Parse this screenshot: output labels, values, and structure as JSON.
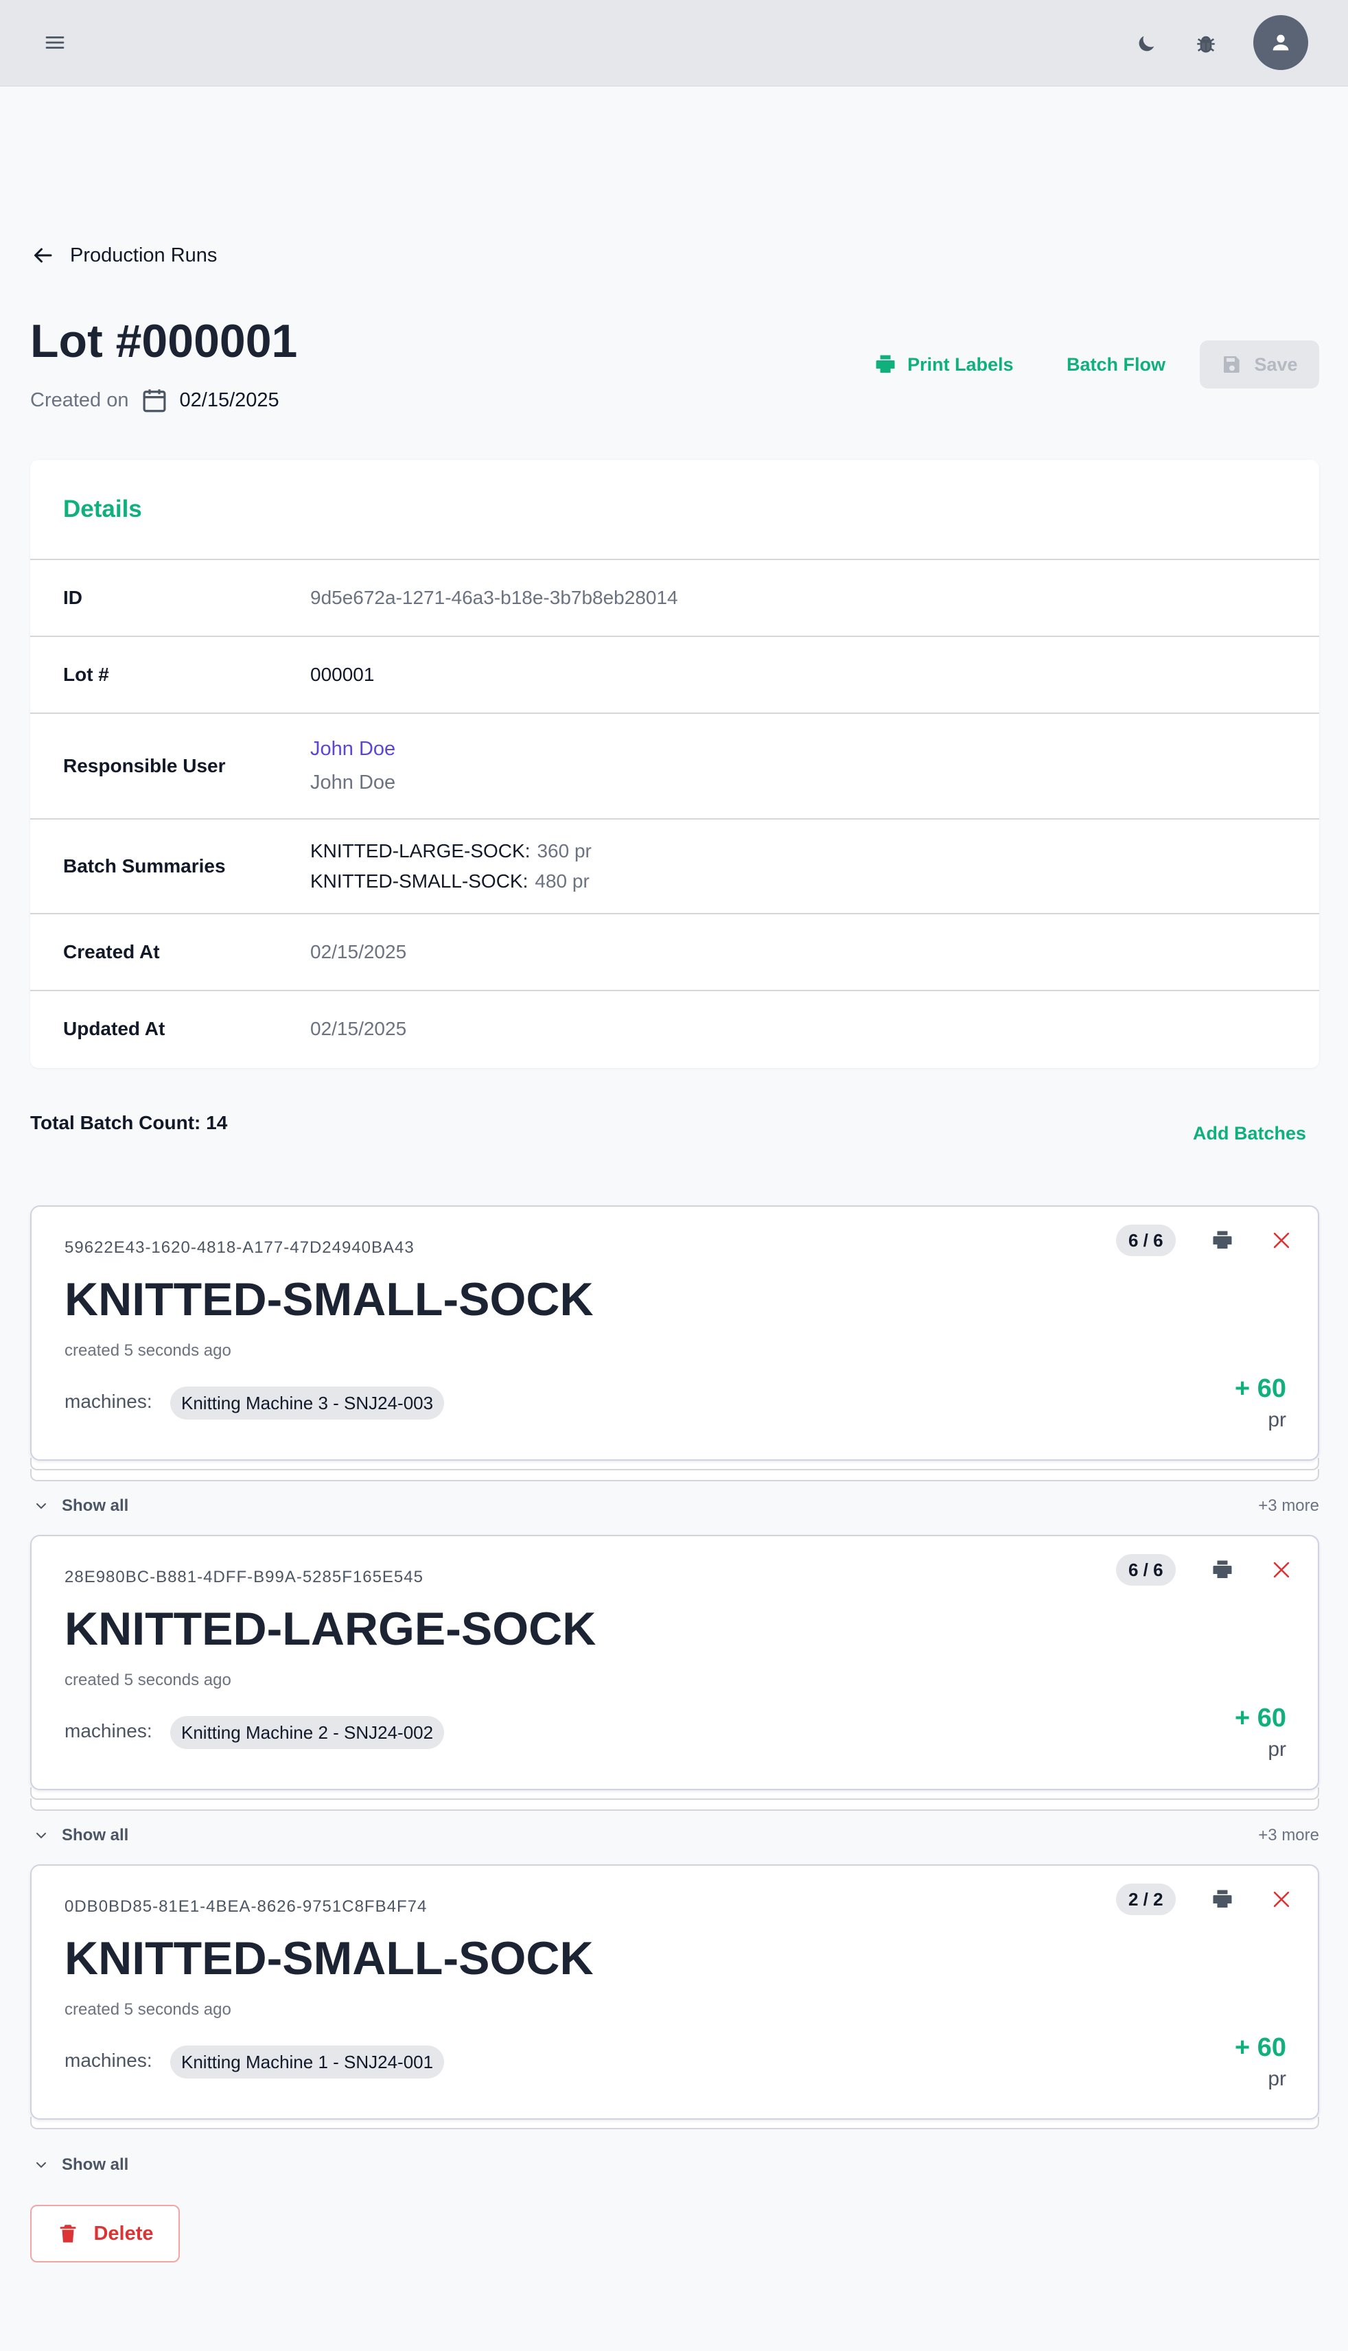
{
  "topbar": {
    "menu_icon": "hamburger-menu-icon",
    "theme_icon": "moon-icon",
    "debug_icon": "bug-icon",
    "avatar_icon": "user-icon"
  },
  "back": {
    "label": "Production Runs"
  },
  "header": {
    "title": "Lot #000001",
    "created_label": "Created on",
    "created_date": "02/15/2025"
  },
  "actions": {
    "print_labels": "Print Labels",
    "batch_flow": "Batch Flow",
    "save": "Save"
  },
  "details": {
    "title": "Details",
    "rows": {
      "id": {
        "label": "ID",
        "value": "9d5e672a-1271-46a3-b18e-3b7b8eb28014"
      },
      "lot": {
        "label": "Lot #",
        "value": "000001"
      },
      "user": {
        "label": "Responsible User",
        "name": "John Doe",
        "sub": "John Doe"
      },
      "batches": {
        "label": "Batch Summaries",
        "items": [
          {
            "product": "KNITTED-LARGE-SOCK:",
            "qty": "360 pr"
          },
          {
            "product": "KNITTED-SMALL-SOCK:",
            "qty": "480 pr"
          }
        ]
      },
      "created": {
        "label": "Created At",
        "value": "02/15/2025"
      },
      "updated": {
        "label": "Updated At",
        "value": "02/15/2025"
      }
    }
  },
  "batches_section": {
    "total": "Total Batch Count: 14",
    "add": "Add Batches",
    "groups": [
      {
        "uid": "59622E43-1620-4818-A177-47D24940BA43",
        "name": "KNITTED-SMALL-SOCK",
        "ago": "created 5 seconds ago",
        "machines_label": "machines:",
        "machine": "Knitting Machine 3 - SNJ24-003",
        "count": "6 / 6",
        "amount": "+ 60",
        "unit": "pr",
        "show_all": "Show all",
        "more": "+3 more"
      },
      {
        "uid": "28E980BC-B881-4DFF-B99A-5285F165E545",
        "name": "KNITTED-LARGE-SOCK",
        "ago": "created 5 seconds ago",
        "machines_label": "machines:",
        "machine": "Knitting Machine 2 - SNJ24-002",
        "count": "6 / 6",
        "amount": "+ 60",
        "unit": "pr",
        "show_all": "Show all",
        "more": "+3 more"
      },
      {
        "uid": "0DB0BD85-81E1-4BEA-8626-9751C8FB4F74",
        "name": "KNITTED-SMALL-SOCK",
        "ago": "created 5 seconds ago",
        "machines_label": "machines:",
        "machine": "Knitting Machine 1 - SNJ24-001",
        "count": "2 / 2",
        "amount": "+ 60",
        "unit": "pr",
        "show_all": "Show all",
        "more": ""
      }
    ]
  },
  "delete": {
    "label": "Delete"
  },
  "colors": {
    "accent": "#10b07c",
    "danger": "#dc3434",
    "link": "#5b46d6"
  }
}
